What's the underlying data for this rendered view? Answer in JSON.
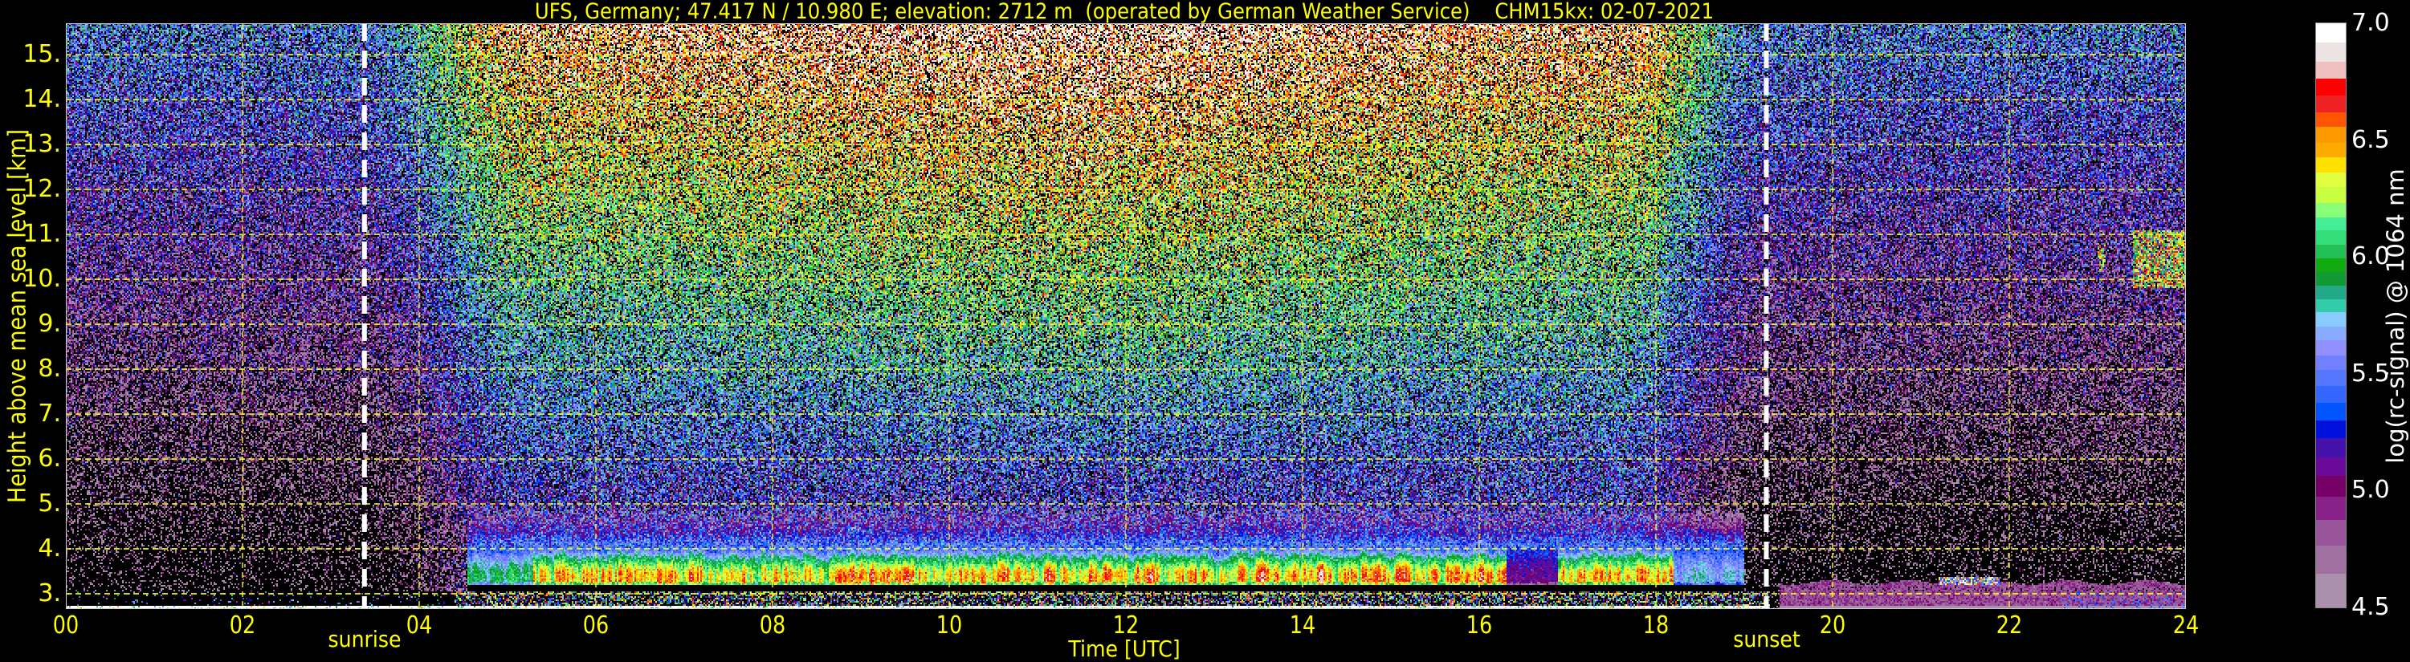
{
  "chart_data": {
    "type": "heatmap",
    "title": "UFS, Germany; 47.417 N / 10.980 E; elevation: 2712 m  (operated by German Weather Service)    CHM15kx: 02-07-2021",
    "xlabel": "Time [UTC]",
    "ylabel": "Height above mean sea level [km]",
    "xlim": [
      0,
      24
    ],
    "ylim": [
      2.66,
      15.7
    ],
    "xticks": [
      0,
      2,
      4,
      6,
      8,
      10,
      12,
      14,
      16,
      18,
      20,
      22,
      24
    ],
    "xtick_labels": [
      "00",
      "02",
      "04",
      "06",
      "08",
      "10",
      "12",
      "14",
      "16",
      "18",
      "20",
      "22",
      "24"
    ],
    "yticks": [
      3,
      4,
      5,
      6,
      7,
      8,
      9,
      10,
      11,
      12,
      13,
      14,
      15
    ],
    "ytick_labels": [
      "3.",
      "4.",
      "5.",
      "6.",
      "7.",
      "8.",
      "9.",
      "10.",
      "11.",
      "12.",
      "13.",
      "14.",
      "15."
    ],
    "grid": true,
    "colorbar": {
      "label": "log(rc-signal) @ 1064 nm",
      "range": [
        4.5,
        7.0
      ],
      "ticks": [
        4.5,
        5.0,
        5.5,
        6.0,
        6.5,
        7.0
      ],
      "tick_labels": [
        "4.5",
        "5.0",
        "5.5",
        "6.0",
        "6.5",
        "7.0"
      ],
      "levels": [
        4.5,
        4.645,
        4.767,
        4.875,
        4.974,
        5.064,
        5.145,
        5.226,
        5.303,
        5.379,
        5.451,
        5.518,
        5.581,
        5.644,
        5.703,
        5.766,
        5.82,
        5.878,
        5.937,
        5.995,
        6.054,
        6.117,
        6.171,
        6.234,
        6.301,
        6.364,
        6.429,
        6.49,
        6.559,
        6.622,
        6.694,
        6.766,
        6.838,
        6.919,
        7.0
      ],
      "colors": [
        "#aa90aa",
        "#a070a0",
        "#995599",
        "#882288",
        "#770066",
        "#6a0a9a",
        "#4411aa",
        "#0011dd",
        "#0055ff",
        "#3366ff",
        "#5577ff",
        "#7080ff",
        "#9090ff",
        "#88aaff",
        "#88ccff",
        "#33ccaa",
        "#22aa88",
        "#119933",
        "#11aa11",
        "#22c055",
        "#33dd77",
        "#44ee99",
        "#88ff77",
        "#c8ff40",
        "#e0ff40",
        "#ffe000",
        "#ffaa00",
        "#ff9900",
        "#ff5500",
        "#ee2222",
        "#ff0000",
        "#f0c0c0",
        "#ece3e3",
        "#ffffff"
      ]
    },
    "annotations": [
      {
        "label": "sunrise",
        "time": 3.38
      },
      {
        "label": "sunset",
        "time": 19.25
      }
    ],
    "features": {
      "boundary_layer": {
        "start": 4.55,
        "end": 19.0,
        "base_km": 3.2,
        "top_km": 4.05
      },
      "cloud": {
        "start": 23.4,
        "end": 24.0,
        "base_km": 9.8,
        "top_km": 11.1
      },
      "night_surface_layer": {
        "start": 19.4,
        "end": 24.0,
        "top_km": 3.25
      }
    }
  }
}
